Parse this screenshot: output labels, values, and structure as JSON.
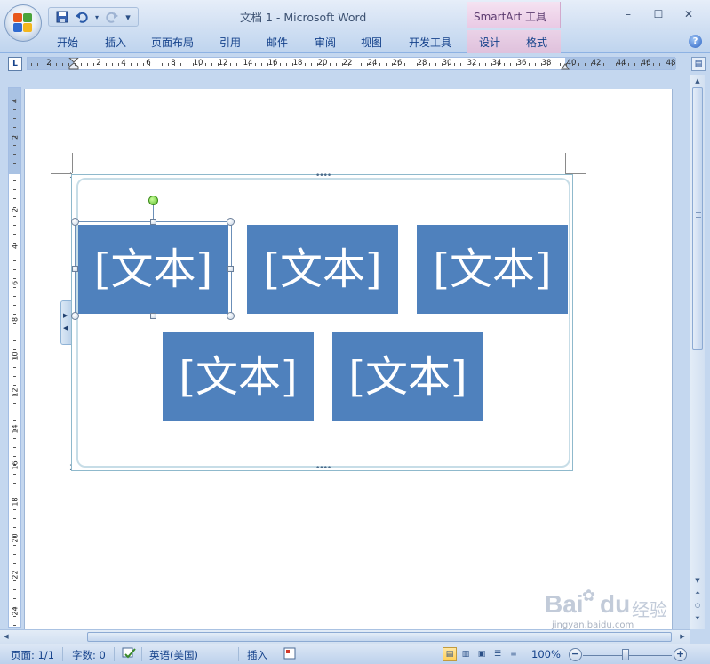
{
  "window": {
    "title": "文档 1 - Microsoft Word",
    "contextual_group": "SmartArt 工具",
    "minimize_icon": "–",
    "maximize_icon": "☐",
    "close_icon": "✕"
  },
  "qat": {
    "save": "save-icon",
    "undo": "undo-icon",
    "redo": "redo-icon",
    "customize": "▾"
  },
  "ribbon_tabs": [
    {
      "label": "开始"
    },
    {
      "label": "插入"
    },
    {
      "label": "页面布局"
    },
    {
      "label": "引用"
    },
    {
      "label": "邮件"
    },
    {
      "label": "审阅"
    },
    {
      "label": "视图"
    },
    {
      "label": "开发工具"
    },
    {
      "label": "设计"
    },
    {
      "label": "格式"
    }
  ],
  "help_label": "?",
  "ruler": {
    "toggle_label": "L",
    "h_numbers": [
      "2",
      "2",
      "4",
      "6",
      "8",
      "10",
      "12",
      "14",
      "16",
      "18",
      "20",
      "22",
      "24",
      "26",
      "28",
      "30",
      "32",
      "34",
      "36",
      "38",
      "40",
      "42",
      "44",
      "46",
      "48"
    ],
    "v_numbers": [
      "4",
      "2",
      "2",
      "4",
      "6",
      "8",
      "10",
      "12",
      "14",
      "16",
      "18",
      "20",
      "22",
      "24"
    ]
  },
  "smartart": {
    "boxes": [
      {
        "text": "[文本]"
      },
      {
        "text": "[文本]"
      },
      {
        "text": "[文本]"
      },
      {
        "text": "[文本]"
      },
      {
        "text": "[文本]"
      }
    ],
    "box_color": "#4f81bd",
    "text_color": "#ffffff"
  },
  "statusbar": {
    "page": "页面: 1/1",
    "words": "字数: 0",
    "language": "英语(美国)",
    "mode": "插入",
    "zoom": "100%",
    "zoom_out": "−",
    "zoom_in": "+"
  },
  "watermark": {
    "brand": "Bai",
    "brand2": "du",
    "cn": "经验",
    "url": "jingyan.baidu.com"
  }
}
